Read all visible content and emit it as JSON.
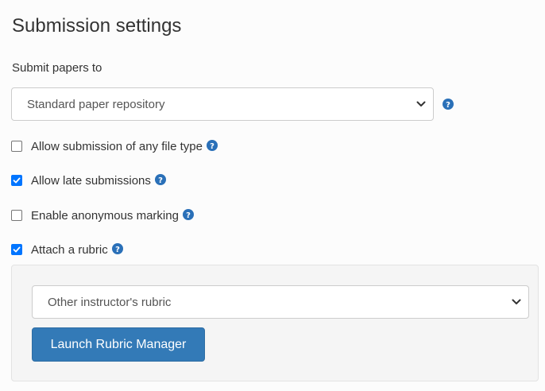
{
  "header": {
    "title": "Submission settings"
  },
  "submit_to": {
    "label": "Submit papers to",
    "selected": "Standard paper repository"
  },
  "options": [
    {
      "label": "Allow submission of any file type",
      "checked": false
    },
    {
      "label": "Allow late submissions",
      "checked": true
    },
    {
      "label": "Enable anonymous marking",
      "checked": false
    },
    {
      "label": "Attach a rubric",
      "checked": true
    }
  ],
  "rubric": {
    "selected": "Other instructor's rubric",
    "launch_label": "Launch Rubric Manager"
  },
  "icons": {
    "help": "question-circle-icon",
    "chevron": "chevron-down-icon",
    "check": "checkmark-icon"
  },
  "colors": {
    "accent": "#2a70b8",
    "primary_button": "#337ab7",
    "checkbox": "#0075ff",
    "well_background": "#f5f5f5"
  }
}
